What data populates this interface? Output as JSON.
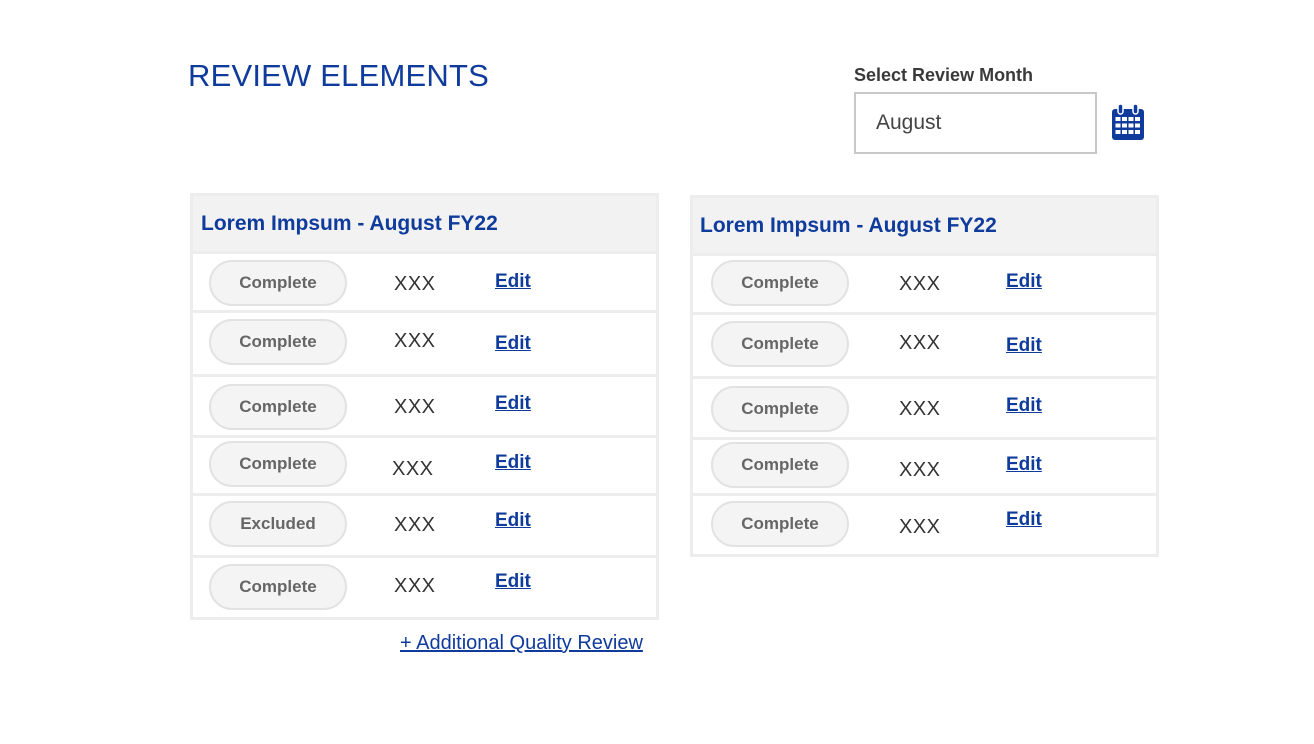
{
  "page_title": "REVIEW ELEMENTS",
  "month_selector": {
    "label": "Select Review Month",
    "value": "August",
    "icon": "calendar-icon"
  },
  "panels": [
    {
      "title": "Lorem Impsum - August FY22",
      "rows": [
        {
          "status": "Complete",
          "value": "XXX",
          "action": "Edit"
        },
        {
          "status": "Complete",
          "value": "XXX",
          "action": "Edit"
        },
        {
          "status": "Complete",
          "value": "XXX",
          "action": "Edit"
        },
        {
          "status": "Complete",
          "value": "XXX",
          "action": "Edit"
        },
        {
          "status": "Excluded",
          "value": "XXX",
          "action": "Edit"
        },
        {
          "status": "Complete",
          "value": "XXX",
          "action": "Edit"
        }
      ]
    },
    {
      "title": "Lorem Impsum - August FY22",
      "rows": [
        {
          "status": "Complete",
          "value": "XXX",
          "action": "Edit"
        },
        {
          "status": "Complete",
          "value": "XXX",
          "action": "Edit"
        },
        {
          "status": "Complete",
          "value": "XXX",
          "action": "Edit"
        },
        {
          "status": "Complete",
          "value": "XXX",
          "action": "Edit"
        },
        {
          "status": "Complete",
          "value": "XXX",
          "action": "Edit"
        }
      ]
    }
  ],
  "add_review_link": "+ Additional Quality Review",
  "colors": {
    "accent": "#0f3b9c",
    "panel_header_bg": "#f2f2f2",
    "border": "#ededed",
    "pill_bg": "#f4f4f4"
  }
}
